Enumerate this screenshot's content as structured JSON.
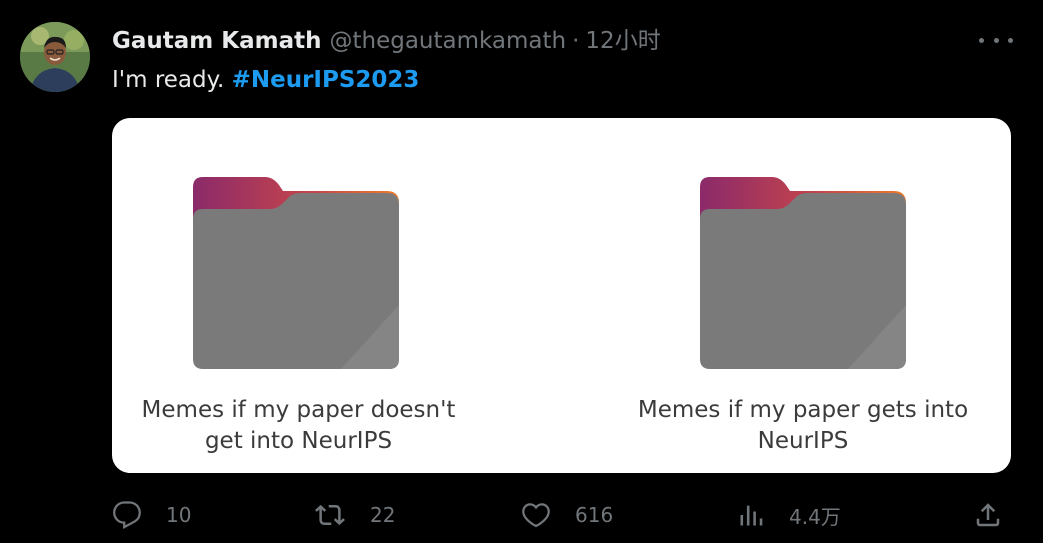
{
  "author": {
    "display_name": "Gautam Kamath",
    "handle": "@thegautamkamath",
    "separator": "·",
    "time": "12小时"
  },
  "tweet": {
    "text": "I'm ready.",
    "hashtag": "#NeurIPS2023"
  },
  "media": {
    "left_caption_line1": "Memes if my paper doesn't",
    "left_caption_line2": "get into NeurIPS",
    "right_caption_line1": "Memes if my paper gets into",
    "right_caption_line2": "NeurIPS"
  },
  "actions": {
    "replies": "10",
    "retweets": "22",
    "likes": "616",
    "views": "4.4万"
  },
  "colors": {
    "background": "#000000",
    "text": "#e7e9ea",
    "muted": "#71767b",
    "hashtag": "#1d9bf0",
    "folder_gray": "#7a7a7a",
    "folder_tab_start": "#8b2a6a",
    "folder_tab_end": "#f07a2a"
  },
  "icons": {
    "more": "more-horizontal-icon",
    "reply": "reply-icon",
    "retweet": "retweet-icon",
    "like": "heart-icon",
    "views": "analytics-icon",
    "share": "share-icon",
    "folder": "folder-icon"
  }
}
